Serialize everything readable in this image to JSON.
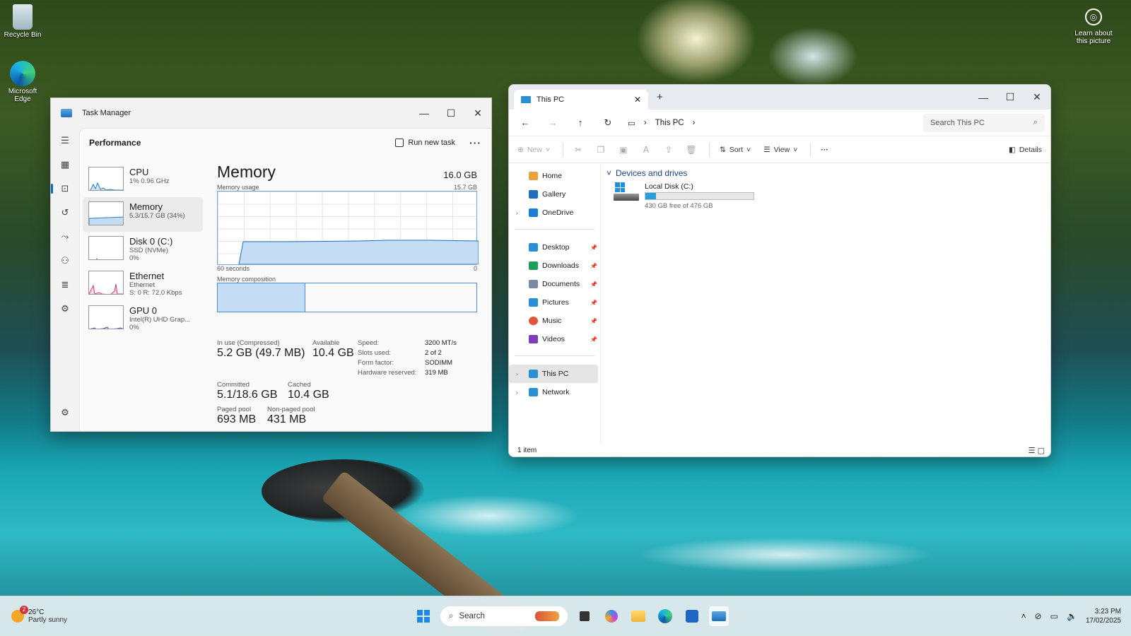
{
  "desktop": {
    "icons": [
      {
        "label": "Recycle Bin"
      },
      {
        "label": "Microsoft Edge"
      }
    ],
    "learn_label": "Learn about this picture"
  },
  "task_manager": {
    "title": "Task Manager",
    "section": "Performance",
    "run_new_task": "Run new task",
    "perf_items": [
      {
        "name": "CPU",
        "sub1": "1% 0.96 GHz",
        "sub2": ""
      },
      {
        "name": "Memory",
        "sub1": "5.3/15.7 GB (34%)",
        "sub2": ""
      },
      {
        "name": "Disk 0 (C:)",
        "sub1": "SSD (NVMe)",
        "sub2": "0%"
      },
      {
        "name": "Ethernet",
        "sub1": "Ethernet",
        "sub2": "S: 0 R: 72.0 Kbps"
      },
      {
        "name": "GPU 0",
        "sub1": "Intel(R) UHD Grap...",
        "sub2": "0%"
      }
    ],
    "memory": {
      "title": "Memory",
      "total": "16.0 GB",
      "usage_label": "Memory usage",
      "usage_max": "15.7 GB",
      "x_left": "60 seconds",
      "x_right": "0",
      "composition_label": "Memory composition",
      "composition_used_fraction": 0.34,
      "in_use_label": "In use (Compressed)",
      "in_use_value": "5.2 GB (49.7 MB)",
      "available_label": "Available",
      "available_value": "10.4 GB",
      "committed_label": "Committed",
      "committed_value": "5.1/18.6 GB",
      "cached_label": "Cached",
      "cached_value": "10.4 GB",
      "paged_label": "Paged pool",
      "paged_value": "693 MB",
      "nonpaged_label": "Non-paged pool",
      "nonpaged_value": "431 MB",
      "speed_label": "Speed:",
      "speed_value": "3200 MT/s",
      "slots_label": "Slots used:",
      "slots_value": "2 of 2",
      "form_label": "Form factor:",
      "form_value": "SODIMM",
      "reserved_label": "Hardware reserved:",
      "reserved_value": "319 MB"
    }
  },
  "explorer": {
    "tab_title": "This PC",
    "breadcrumb": "This PC",
    "search_placeholder": "Search This PC",
    "commands": {
      "new": "New",
      "sort": "Sort",
      "view": "View",
      "details": "Details"
    },
    "sidebar": [
      {
        "label": "Home",
        "color": "#e8a33c"
      },
      {
        "label": "Gallery",
        "color": "#1f6fbf"
      },
      {
        "label": "OneDrive",
        "color": "#1d7bd4"
      },
      {
        "label": "Desktop",
        "color": "#2b8fd6"
      },
      {
        "label": "Downloads",
        "color": "#1f9e5a"
      },
      {
        "label": "Documents",
        "color": "#7b8aa0"
      },
      {
        "label": "Pictures",
        "color": "#2b8fd6"
      },
      {
        "label": "Music",
        "color": "#e0563b"
      },
      {
        "label": "Videos",
        "color": "#7a3fb8"
      },
      {
        "label": "This PC",
        "color": "#2b8fd6"
      },
      {
        "label": "Network",
        "color": "#2b8fd6"
      }
    ],
    "group": "Devices and drives",
    "drive": {
      "name": "Local Disk (C:)",
      "free": "430 GB free of 476 GB",
      "used_fraction": 0.097
    },
    "status": "1 item"
  },
  "taskbar": {
    "weather_temp": "26°C",
    "weather_desc": "Partly sunny",
    "weather_badge": "2",
    "search_label": "Search",
    "time": "3:23 PM",
    "date": "17/02/2025"
  }
}
